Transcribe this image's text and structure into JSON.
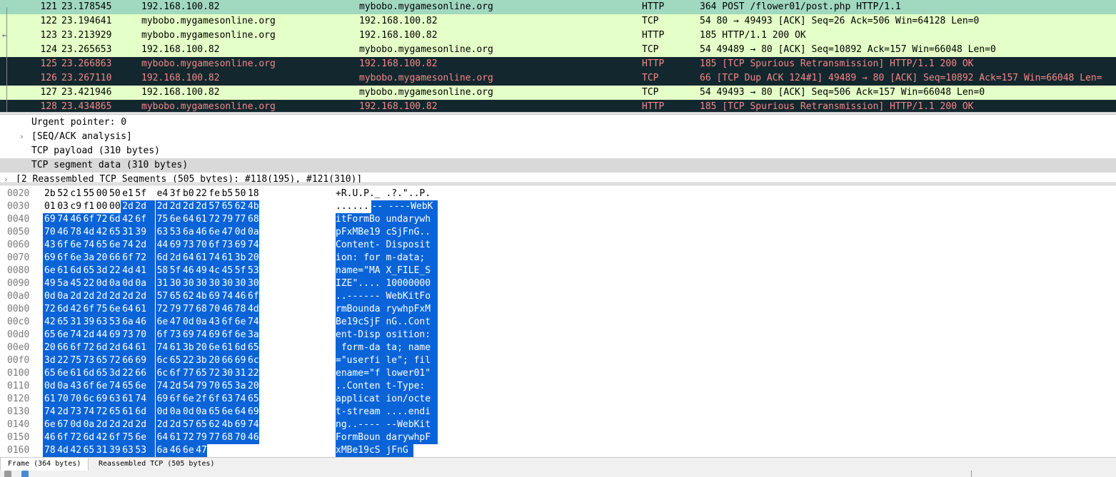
{
  "colors": {
    "http_row_bg": "#e4ffc7",
    "http_row_selected_bg": "#a0d8c0",
    "bad_row_bg": "#12272e",
    "bad_row_fg": "#f78787",
    "hex_selection": "#0a64d8"
  },
  "packets": [
    {
      "no": "121",
      "time": "23.178545",
      "src": "192.168.100.82",
      "dst": "mybobo.mygamesonline.org",
      "proto": "HTTP",
      "info": "364 POST /flower01/post.php HTTP/1.1",
      "style": "sel",
      "gutter": "top"
    },
    {
      "no": "122",
      "time": "23.194641",
      "src": "mybobo.mygamesonline.org",
      "dst": "192.168.100.82",
      "proto": "TCP",
      "info": "54 80 → 49493 [ACK] Seq=26 Ack=506 Win=64128 Len=0",
      "style": "normal",
      "gutter": "line"
    },
    {
      "no": "123",
      "time": "23.213929",
      "src": "mybobo.mygamesonline.org",
      "dst": "192.168.100.82",
      "proto": "HTTP",
      "info": "185 HTTP/1.1 200 OK",
      "style": "normal",
      "gutter": "arrow"
    },
    {
      "no": "124",
      "time": "23.265653",
      "src": "192.168.100.82",
      "dst": "mybobo.mygamesonline.org",
      "proto": "TCP",
      "info": "54 49489 → 80 [ACK] Seq=10892 Ack=157 Win=66048 Len=0",
      "style": "normal",
      "gutter": "line"
    },
    {
      "no": "125",
      "time": "23.266863",
      "src": "mybobo.mygamesonline.org",
      "dst": "192.168.100.82",
      "proto": "HTTP",
      "info": "185 [TCP Spurious Retransmission] HTTP/1.1 200 OK",
      "style": "bad",
      "gutter": "line"
    },
    {
      "no": "126",
      "time": "23.267110",
      "src": "192.168.100.82",
      "dst": "mybobo.mygamesonline.org",
      "proto": "TCP",
      "info": "66 [TCP Dup ACK 124#1] 49489 → 80 [ACK] Seq=10892 Ack=157 Win=66048 Len=",
      "style": "bad",
      "gutter": "line"
    },
    {
      "no": "127",
      "time": "23.421946",
      "src": "192.168.100.82",
      "dst": "mybobo.mygamesonline.org",
      "proto": "TCP",
      "info": "54 49493 → 80 [ACK] Seq=506 Ack=157 Win=66048 Len=0",
      "style": "normal",
      "gutter": "line"
    },
    {
      "no": "128",
      "time": "23.434865",
      "src": "mybobo.mygamesonline.org",
      "dst": "192.168.100.82",
      "proto": "HTTP",
      "info": "185 [TCP Spurious Retransmission] HTTP/1.1 200 OK",
      "style": "bad",
      "gutter": "line"
    }
  ],
  "details": [
    {
      "label": "Urgent pointer: 0",
      "expander": "",
      "indent": 2,
      "selected": false
    },
    {
      "label": "[SEQ/ACK analysis]",
      "expander": "›",
      "indent": 2,
      "selected": false
    },
    {
      "label": "TCP payload (310 bytes)",
      "expander": "",
      "indent": 2,
      "selected": false
    },
    {
      "label": "TCP segment data (310 bytes)",
      "expander": "",
      "indent": 2,
      "selected": true
    },
    {
      "label": "[2 Reassembled TCP Segments (505 bytes): #118(195), #121(310)]",
      "expander": "›",
      "indent": 1,
      "selected": false
    }
  ],
  "hex": [
    {
      "offset": "0020",
      "bytes": [
        "2b",
        "52",
        "c1",
        "55",
        "00",
        "50",
        "e1",
        "5f",
        "e4",
        "3f",
        "b0",
        "22",
        "fe",
        "b5",
        "50",
        "18"
      ],
      "ascii": "+R.U.P._ .?.\"..P.",
      "selStart": 16
    },
    {
      "offset": "0030",
      "bytes": [
        "01",
        "03",
        "c9",
        "f1",
        "00",
        "00",
        "2d",
        "2d",
        "2d",
        "2d",
        "2d",
        "2d",
        "57",
        "65",
        "62",
        "4b"
      ],
      "ascii": "......-- ----WebK",
      "selStart": 6
    },
    {
      "offset": "0040",
      "bytes": [
        "69",
        "74",
        "46",
        "6f",
        "72",
        "6d",
        "42",
        "6f",
        "75",
        "6e",
        "64",
        "61",
        "72",
        "79",
        "77",
        "68"
      ],
      "ascii": "itFormBo undarywh",
      "selStart": 0
    },
    {
      "offset": "0050",
      "bytes": [
        "70",
        "46",
        "78",
        "4d",
        "42",
        "65",
        "31",
        "39",
        "63",
        "53",
        "6a",
        "46",
        "6e",
        "47",
        "0d",
        "0a"
      ],
      "ascii": "pFxMBe19 cSjFnG..",
      "selStart": 0
    },
    {
      "offset": "0060",
      "bytes": [
        "43",
        "6f",
        "6e",
        "74",
        "65",
        "6e",
        "74",
        "2d",
        "44",
        "69",
        "73",
        "70",
        "6f",
        "73",
        "69",
        "74"
      ],
      "ascii": "Content- Disposit",
      "selStart": 0
    },
    {
      "offset": "0070",
      "bytes": [
        "69",
        "6f",
        "6e",
        "3a",
        "20",
        "66",
        "6f",
        "72",
        "6d",
        "2d",
        "64",
        "61",
        "74",
        "61",
        "3b",
        "20"
      ],
      "ascii": "ion: for m-data; ",
      "selStart": 0
    },
    {
      "offset": "0080",
      "bytes": [
        "6e",
        "61",
        "6d",
        "65",
        "3d",
        "22",
        "4d",
        "41",
        "58",
        "5f",
        "46",
        "49",
        "4c",
        "45",
        "5f",
        "53"
      ],
      "ascii": "name=\"MA X_FILE_S",
      "selStart": 0
    },
    {
      "offset": "0090",
      "bytes": [
        "49",
        "5a",
        "45",
        "22",
        "0d",
        "0a",
        "0d",
        "0a",
        "31",
        "30",
        "30",
        "30",
        "30",
        "30",
        "30",
        "30"
      ],
      "ascii": "IZE\".... 10000000",
      "selStart": 0
    },
    {
      "offset": "00a0",
      "bytes": [
        "0d",
        "0a",
        "2d",
        "2d",
        "2d",
        "2d",
        "2d",
        "2d",
        "57",
        "65",
        "62",
        "4b",
        "69",
        "74",
        "46",
        "6f"
      ],
      "ascii": "..------ WebKitFo",
      "selStart": 0
    },
    {
      "offset": "00b0",
      "bytes": [
        "72",
        "6d",
        "42",
        "6f",
        "75",
        "6e",
        "64",
        "61",
        "72",
        "79",
        "77",
        "68",
        "70",
        "46",
        "78",
        "4d"
      ],
      "ascii": "rmBounda rywhpFxM",
      "selStart": 0
    },
    {
      "offset": "00c0",
      "bytes": [
        "42",
        "65",
        "31",
        "39",
        "63",
        "53",
        "6a",
        "46",
        "6e",
        "47",
        "0d",
        "0a",
        "43",
        "6f",
        "6e",
        "74"
      ],
      "ascii": "Be19cSjF nG..Cont",
      "selStart": 0
    },
    {
      "offset": "00d0",
      "bytes": [
        "65",
        "6e",
        "74",
        "2d",
        "44",
        "69",
        "73",
        "70",
        "6f",
        "73",
        "69",
        "74",
        "69",
        "6f",
        "6e",
        "3a"
      ],
      "ascii": "ent-Disp osition:",
      "selStart": 0
    },
    {
      "offset": "00e0",
      "bytes": [
        "20",
        "66",
        "6f",
        "72",
        "6d",
        "2d",
        "64",
        "61",
        "74",
        "61",
        "3b",
        "20",
        "6e",
        "61",
        "6d",
        "65"
      ],
      "ascii": " form-da ta; name",
      "selStart": 0
    },
    {
      "offset": "00f0",
      "bytes": [
        "3d",
        "22",
        "75",
        "73",
        "65",
        "72",
        "66",
        "69",
        "6c",
        "65",
        "22",
        "3b",
        "20",
        "66",
        "69",
        "6c"
      ],
      "ascii": "=\"userfi le\"; fil",
      "selStart": 0
    },
    {
      "offset": "0100",
      "bytes": [
        "65",
        "6e",
        "61",
        "6d",
        "65",
        "3d",
        "22",
        "66",
        "6c",
        "6f",
        "77",
        "65",
        "72",
        "30",
        "31",
        "22"
      ],
      "ascii": "ename=\"f lower01\"",
      "selStart": 0
    },
    {
      "offset": "0110",
      "bytes": [
        "0d",
        "0a",
        "43",
        "6f",
        "6e",
        "74",
        "65",
        "6e",
        "74",
        "2d",
        "54",
        "79",
        "70",
        "65",
        "3a",
        "20"
      ],
      "ascii": "..Conten t-Type: ",
      "selStart": 0
    },
    {
      "offset": "0120",
      "bytes": [
        "61",
        "70",
        "70",
        "6c",
        "69",
        "63",
        "61",
        "74",
        "69",
        "6f",
        "6e",
        "2f",
        "6f",
        "63",
        "74",
        "65"
      ],
      "ascii": "applicat ion/octe",
      "selStart": 0
    },
    {
      "offset": "0130",
      "bytes": [
        "74",
        "2d",
        "73",
        "74",
        "72",
        "65",
        "61",
        "6d",
        "0d",
        "0a",
        "0d",
        "0a",
        "65",
        "6e",
        "64",
        "69"
      ],
      "ascii": "t-stream ....endi",
      "selStart": 0
    },
    {
      "offset": "0140",
      "bytes": [
        "6e",
        "67",
        "0d",
        "0a",
        "2d",
        "2d",
        "2d",
        "2d",
        "2d",
        "2d",
        "57",
        "65",
        "62",
        "4b",
        "69",
        "74"
      ],
      "ascii": "ng..---- --WebKit",
      "selStart": 0
    },
    {
      "offset": "0150",
      "bytes": [
        "46",
        "6f",
        "72",
        "6d",
        "42",
        "6f",
        "75",
        "6e",
        "64",
        "61",
        "72",
        "79",
        "77",
        "68",
        "70",
        "46"
      ],
      "ascii": "FormBoun darywhpF",
      "selStart": 0
    },
    {
      "offset": "0160",
      "bytes": [
        "78",
        "4d",
        "42",
        "65",
        "31",
        "39",
        "63",
        "53",
        "6a",
        "46",
        "6e",
        "47"
      ],
      "ascii": "xMBe19cS jFnG",
      "selStart": 0
    }
  ],
  "byte_tabs": [
    {
      "label": "Frame (364 bytes)",
      "active": true
    },
    {
      "label": "Reassembled TCP (505 bytes)",
      "active": false
    }
  ]
}
